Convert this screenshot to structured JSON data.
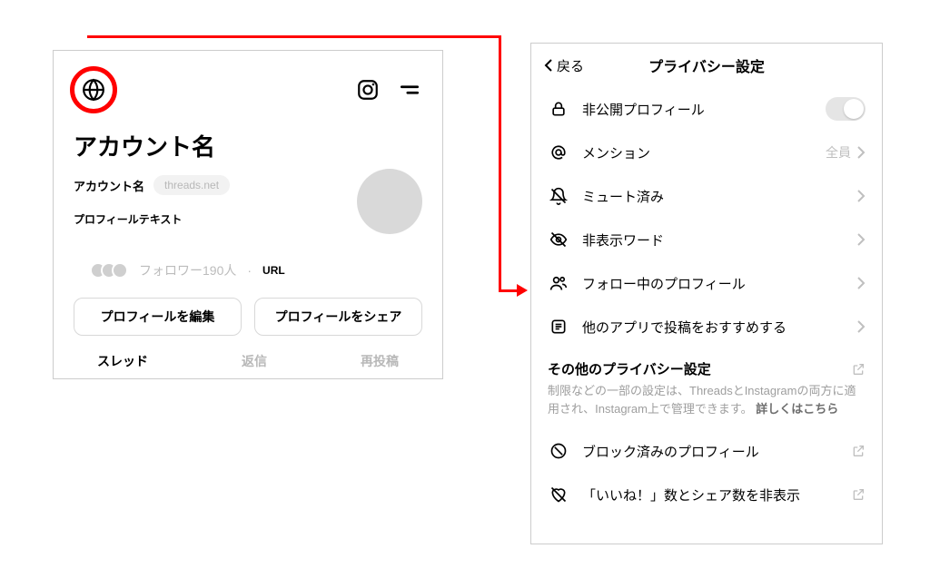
{
  "profile": {
    "display_name": "アカウント名",
    "username_label": "アカウント名",
    "threads_badge": "threads.net",
    "bio_label": "プロフィールテキスト",
    "followers_text": "フォロワー190人",
    "url_label": "URL",
    "edit_button": "プロフィールを編集",
    "share_button": "プロフィールをシェア",
    "tabs": {
      "threads": "スレッド",
      "replies": "返信",
      "reposts": "再投稿"
    }
  },
  "privacy": {
    "back_label": "戻る",
    "title": "プライバシー設定",
    "rows": {
      "private_profile": "非公開プロフィール",
      "mentions": "メンション",
      "mentions_value": "全員",
      "muted": "ミュート済み",
      "hidden_words": "非表示ワード",
      "following_profiles": "フォロー中のプロフィール",
      "suggest_other_apps": "他のアプリで投稿をおすすめする"
    },
    "other_section": {
      "header": "その他のプライバシー設定",
      "desc": "制限などの一部の設定は、ThreadsとInstagramの両方に適用され、Instagram上で管理できます。",
      "more": "詳しくはこちら"
    },
    "rows2": {
      "blocked": "ブロック済みのプロフィール",
      "hide_likes": "「いいね！」数とシェア数を非表示"
    }
  }
}
